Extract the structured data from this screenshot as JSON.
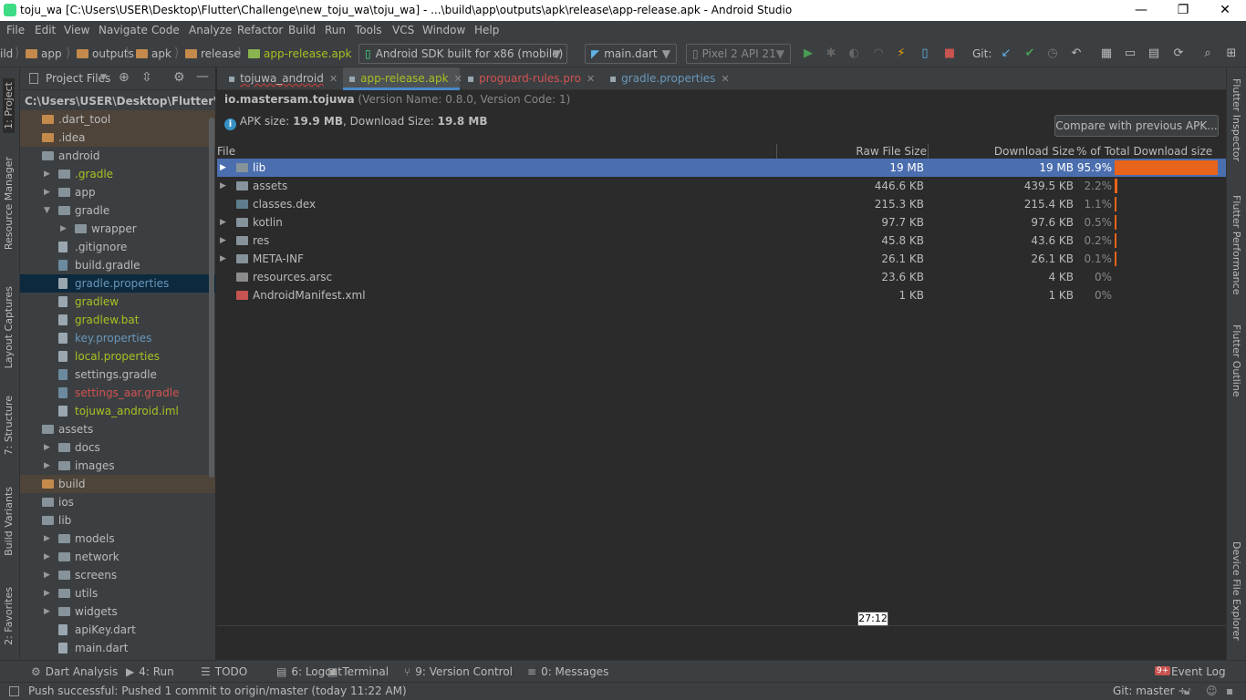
{
  "window": {
    "title": "toju_wa [C:\\Users\\USER\\Desktop\\Flutter\\Challenge\\new_toju_wa\\toju_wa] - ...\\build\\app\\outputs\\apk\\release\\app-release.apk - Android Studio",
    "minimize": "—",
    "restore": "❐",
    "close": "✕"
  },
  "menu": [
    "File",
    "Edit",
    "View",
    "Navigate",
    "Code",
    "Analyze",
    "Refactor",
    "Build",
    "Run",
    "Tools",
    "VCS",
    "Window",
    "Help"
  ],
  "breadcrumbs": [
    "ild",
    "app",
    "outputs",
    "apk",
    "release",
    "app-release.apk"
  ],
  "toolbar": {
    "device_target": "Android SDK built for x86 (mobile)",
    "run_config": "main.dart",
    "avd": "Pixel 2 API 21",
    "git_label": "Git:"
  },
  "left_stripe": [
    "1: Project",
    "Resource Manager",
    "Layout Captures",
    "7: Structure",
    "Build Variants",
    "2: Favorites"
  ],
  "right_stripe": [
    "Flutter Inspector",
    "Flutter Performance",
    "Flutter Outline",
    "Device File Explorer"
  ],
  "project": {
    "view_label": "Project Files",
    "root_path": "C:\\Users\\USER\\Desktop\\Flutter\\Challe",
    "items": [
      {
        "label": ".dart_tool",
        "indent": 0,
        "arrow": "",
        "color": "#bbbbbb",
        "icon": "folder-orange",
        "hl": "excluded"
      },
      {
        "label": ".idea",
        "indent": 0,
        "arrow": "",
        "color": "#bbbbbb",
        "icon": "folder-orange",
        "hl": "excluded"
      },
      {
        "label": "android",
        "indent": 0,
        "arrow": "",
        "color": "#bbbbbb",
        "icon": "folder",
        "hl": ""
      },
      {
        "label": ".gradle",
        "indent": 1,
        "arrow": "▶",
        "color": "#a8c023",
        "icon": "folder",
        "hl": ""
      },
      {
        "label": "app",
        "indent": 1,
        "arrow": "▶",
        "color": "#bbbbbb",
        "icon": "folder",
        "hl": ""
      },
      {
        "label": "gradle",
        "indent": 1,
        "arrow": "▼",
        "color": "#bbbbbb",
        "icon": "folder",
        "hl": ""
      },
      {
        "label": "wrapper",
        "indent": 2,
        "arrow": "▶",
        "color": "#bbbbbb",
        "icon": "folder",
        "hl": ""
      },
      {
        "label": ".gitignore",
        "indent": 1,
        "arrow": "",
        "color": "#bbbbbb",
        "icon": "file",
        "hl": ""
      },
      {
        "label": "build.gradle",
        "indent": 1,
        "arrow": "",
        "color": "#bbbbbb",
        "icon": "gradle",
        "hl": ""
      },
      {
        "label": "gradle.properties",
        "indent": 1,
        "arrow": "",
        "color": "#6897bb",
        "icon": "props",
        "hl": "selected"
      },
      {
        "label": "gradlew",
        "indent": 1,
        "arrow": "",
        "color": "#a8c023",
        "icon": "file",
        "hl": ""
      },
      {
        "label": "gradlew.bat",
        "indent": 1,
        "arrow": "",
        "color": "#a8c023",
        "icon": "file",
        "hl": ""
      },
      {
        "label": "key.properties",
        "indent": 1,
        "arrow": "",
        "color": "#6897bb",
        "icon": "props",
        "hl": ""
      },
      {
        "label": "local.properties",
        "indent": 1,
        "arrow": "",
        "color": "#a8c023",
        "icon": "props",
        "hl": ""
      },
      {
        "label": "settings.gradle",
        "indent": 1,
        "arrow": "",
        "color": "#bbbbbb",
        "icon": "gradle",
        "hl": ""
      },
      {
        "label": "settings_aar.gradle",
        "indent": 1,
        "arrow": "",
        "color": "#d25252",
        "icon": "gradle",
        "hl": ""
      },
      {
        "label": "tojuwa_android.iml",
        "indent": 1,
        "arrow": "",
        "color": "#a8c023",
        "icon": "file",
        "hl": ""
      },
      {
        "label": "assets",
        "indent": 0,
        "arrow": "",
        "color": "#bbbbbb",
        "icon": "folder",
        "hl": ""
      },
      {
        "label": "docs",
        "indent": 1,
        "arrow": "▶",
        "color": "#bbbbbb",
        "icon": "folder",
        "hl": ""
      },
      {
        "label": "images",
        "indent": 1,
        "arrow": "▶",
        "color": "#bbbbbb",
        "icon": "folder",
        "hl": ""
      },
      {
        "label": "build",
        "indent": 0,
        "arrow": "",
        "color": "#bbbbbb",
        "icon": "folder-orange",
        "hl": "excluded"
      },
      {
        "label": "ios",
        "indent": 0,
        "arrow": "",
        "color": "#bbbbbb",
        "icon": "folder",
        "hl": ""
      },
      {
        "label": "lib",
        "indent": 0,
        "arrow": "",
        "color": "#bbbbbb",
        "icon": "folder",
        "hl": ""
      },
      {
        "label": "models",
        "indent": 1,
        "arrow": "▶",
        "color": "#bbbbbb",
        "icon": "folder",
        "hl": ""
      },
      {
        "label": "network",
        "indent": 1,
        "arrow": "▶",
        "color": "#bbbbbb",
        "icon": "folder",
        "hl": ""
      },
      {
        "label": "screens",
        "indent": 1,
        "arrow": "▶",
        "color": "#bbbbbb",
        "icon": "folder",
        "hl": ""
      },
      {
        "label": "utils",
        "indent": 1,
        "arrow": "▶",
        "color": "#bbbbbb",
        "icon": "folder",
        "hl": ""
      },
      {
        "label": "widgets",
        "indent": 1,
        "arrow": "▶",
        "color": "#bbbbbb",
        "icon": "folder",
        "hl": ""
      },
      {
        "label": "apiKey.dart",
        "indent": 1,
        "arrow": "",
        "color": "#bbbbbb",
        "icon": "dart",
        "hl": ""
      },
      {
        "label": "main.dart",
        "indent": 1,
        "arrow": "",
        "color": "#bbbbbb",
        "icon": "dart",
        "hl": ""
      }
    ]
  },
  "tabs": [
    {
      "label": "tojuwa_android",
      "color": "#bbbbbb",
      "active": false,
      "underline": true
    },
    {
      "label": "app-release.apk",
      "color": "#a8c023",
      "active": true,
      "underline": false
    },
    {
      "label": "proguard-rules.pro",
      "color": "#d25252",
      "active": false,
      "underline": false
    },
    {
      "label": "gradle.properties",
      "color": "#6897bb",
      "active": false,
      "underline": false
    }
  ],
  "apk": {
    "package": "io.mastersam.tojuwa",
    "version": "(Version Name: 0.8.0, Version Code: 1)",
    "size_label": "APK size:",
    "size_value": "19.9 MB",
    "dl_label": ", Download Size:",
    "dl_value": "19.8 MB",
    "compare_button": "Compare with previous APK...",
    "columns": {
      "file": "File",
      "raw": "Raw File Size",
      "download": "Download Size",
      "percent": "% of Total Download size"
    },
    "rows": [
      {
        "name": "lib",
        "arrow": "▶",
        "icon": "folder",
        "raw": "19 MB",
        "download": "19 MB",
        "percent": "95.9%",
        "fraction": 0.959
      },
      {
        "name": "assets",
        "arrow": "▶",
        "icon": "folder",
        "raw": "446.6 KB",
        "download": "439.5 KB",
        "percent": "2.2%",
        "fraction": 0.022
      },
      {
        "name": "classes.dex",
        "arrow": "",
        "icon": "dex",
        "raw": "215.3 KB",
        "download": "215.4 KB",
        "percent": "1.1%",
        "fraction": 0.011
      },
      {
        "name": "kotlin",
        "arrow": "▶",
        "icon": "folder",
        "raw": "97.7 KB",
        "download": "97.6 KB",
        "percent": "0.5%",
        "fraction": 0.005
      },
      {
        "name": "res",
        "arrow": "▶",
        "icon": "res",
        "raw": "45.8 KB",
        "download": "43.6 KB",
        "percent": "0.2%",
        "fraction": 0.002
      },
      {
        "name": "META-INF",
        "arrow": "▶",
        "icon": "folder",
        "raw": "26.1 KB",
        "download": "26.1 KB",
        "percent": "0.1%",
        "fraction": 0.001
      },
      {
        "name": "resources.arsc",
        "arrow": "",
        "icon": "arsc",
        "raw": "23.6 KB",
        "download": "4 KB",
        "percent": "0%",
        "fraction": 0
      },
      {
        "name": "AndroidManifest.xml",
        "arrow": "",
        "icon": "xml",
        "raw": "1 KB",
        "download": "1 KB",
        "percent": "0%",
        "fraction": 0
      }
    ]
  },
  "tooltip": "27:12",
  "bottom_tabs": [
    {
      "label": "Dart Analysis",
      "icon": "⚙"
    },
    {
      "label": "4: Run",
      "icon": "▶"
    },
    {
      "label": "TODO",
      "icon": "☰"
    },
    {
      "label": "6: Logcat",
      "icon": "▤"
    },
    {
      "label": "Terminal",
      "icon": "▣"
    },
    {
      "label": "9: Version Control",
      "icon": "⑂"
    },
    {
      "label": "0: Messages",
      "icon": "≡"
    }
  ],
  "event_log": "Event Log",
  "event_badge": "9+",
  "status": {
    "message": "Push successful: Pushed 1 commit to origin/master (today 11:22 AM)",
    "git_branch": "Git: master ÷"
  },
  "colors": {
    "selection": "#4b6eaf",
    "bar": "#e8641b",
    "accent_green": "#3ddc84",
    "run_green": "#499c54"
  }
}
